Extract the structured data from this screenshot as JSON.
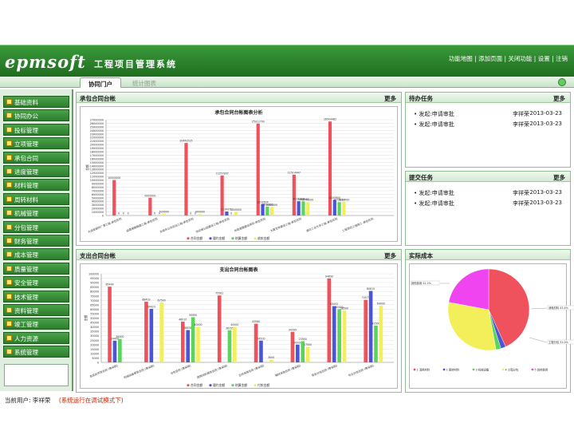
{
  "app": {
    "logo": "epmsoft",
    "title": "工程项目管理系统"
  },
  "top_links": [
    "功能地图",
    "添加页面",
    "关闭功能",
    "设置",
    "注销"
  ],
  "tabs": [
    "协同门户",
    "统计图表"
  ],
  "menu": [
    "基础资料",
    "协同办公",
    "投标管理",
    "立项管理",
    "承包合同",
    "进度管理",
    "材料管理",
    "周转材料",
    "机械管理",
    "分包管理",
    "财务管理",
    "成本管理",
    "质量管理",
    "安全管理",
    "技术管理",
    "资料管理",
    "竣工管理",
    "人力资源",
    "系统管理"
  ],
  "panels": {
    "contract": {
      "title": "承包合同台帐",
      "more": "更多",
      "chart_title": "承包合同台帐图表分析"
    },
    "outsource": {
      "title": "支出合同台帐",
      "more": "更多",
      "chart_title": "支出合同台帐图表"
    },
    "todo": {
      "title": "待办任务",
      "more": "更多",
      "items": [
        {
          "name": "发起:申请审批",
          "user": "李祥荣",
          "date": "2013-03-23"
        },
        {
          "name": "发起:申请审批",
          "user": "李祥荣",
          "date": "2013-03-23"
        }
      ]
    },
    "submit": {
      "title": "提交任务",
      "more": "更多",
      "items": [
        {
          "name": "发起:申请审批",
          "user": "李祥荣",
          "date": "2013-03-23"
        },
        {
          "name": "发起:申请审批",
          "user": "李祥荣",
          "date": "2013-03-23"
        }
      ]
    },
    "cost": {
      "title": "实际成本"
    }
  },
  "status": {
    "user_label": "当前用户: 李祥荣",
    "mode": "(系统运行在调试模式下)"
  },
  "colors": {
    "red": "#f0525d",
    "blue": "#4a55d8",
    "green": "#59d45c",
    "yellow": "#f3ef5a",
    "magenta": "#ef44ef",
    "header_green": "#2d7d2d"
  },
  "chart_data": [
    {
      "type": "bar",
      "title": "承包合同台帐图表分析",
      "ylabel": "金额",
      "ylim": [
        0,
        27000000
      ],
      "yticks": [
        0,
        1000000,
        2000000,
        3000000,
        4000000,
        5000000,
        6000000,
        7000000,
        8000000,
        9000000,
        10000000,
        11000000,
        12000000,
        13000000,
        14000000,
        15000000,
        16000000,
        17000000,
        18000000,
        19000000,
        20000000,
        21000000,
        22000000,
        23000000,
        24000000,
        25000000,
        26000000,
        27000000
      ],
      "categories": [
        "大润发超市广源工程-承包合同",
        "成高速路路面工程-承包合同",
        "东莞市公交总站工程-承包合同",
        "世纪城公园建设工程-承包合同",
        "市政道路建设项目-承包合同",
        "大厦主体建设工程-承包合同",
        "湖北工业大学工程-承包合同",
        "工程项目工程施工-承包合同"
      ],
      "series": [
        {
          "name": "合同金额",
          "values": [
            10000000,
            5000000,
            20442515,
            11257907,
            25912700,
            11514447,
            26504482,
            0
          ]
        },
        {
          "name": "履约金额",
          "values": [
            0,
            0,
            0,
            1134370,
            3201604,
            4021204,
            4403900,
            0
          ]
        },
        {
          "name": "结算金额",
          "values": [
            0,
            0,
            0,
            0,
            2500000,
            3964567,
            3773117,
            0
          ]
        },
        {
          "name": "收款金额",
          "values": [
            0,
            500000,
            400000,
            1000000,
            2400000,
            3770000,
            3860000,
            0
          ]
        }
      ],
      "data_labels": [
        [
          "10000000",
          "0",
          "0",
          "0"
        ],
        [
          "5000000",
          "0",
          "0",
          "500000"
        ],
        [
          "20442515",
          "0",
          "0",
          "400000"
        ],
        [
          "11257907",
          "1134370",
          "0",
          "1000000"
        ],
        [
          "25912700",
          "3201604",
          "2500000",
          "2400000"
        ],
        [
          "11514447",
          "4021204",
          "3964567",
          "3770000"
        ],
        [
          "26504482",
          "4403900",
          "3773117",
          "3860000"
        ],
        [
          "",
          "",
          "",
          ""
        ]
      ],
      "legend_position": "bottom"
    },
    {
      "type": "bar",
      "title": "支出合同台帐图表",
      "ylabel": "金额",
      "ylim": [
        0,
        100000
      ],
      "yticks": [
        0,
        5000,
        10000,
        15000,
        20000,
        25000,
        30000,
        35000,
        40000,
        45000,
        50000,
        55000,
        60000,
        65000,
        70000,
        75000,
        80000,
        85000,
        90000,
        95000,
        100000
      ],
      "categories": [
        "商品砼供货合同 (零采购)",
        "机械设备租赁合同 (零采购)",
        "分包合同 (零采购)",
        "周转材料租赁合同 (零采购)",
        "主材采购合同 (零采购)",
        "辅材采购合同 (零采购)",
        "劳务分包合同 (零采购)",
        "专业分包合同 (零采购)"
      ],
      "series": [
        {
          "name": "合同金额",
          "values": [
            85444,
            68403,
            46010,
            75561,
            43560,
            34395,
            94690,
            70573
          ]
        },
        {
          "name": "履约金额",
          "values": [
            24400,
            60423,
            36450,
            0,
            24500,
            20000,
            63452,
            80615
          ]
        },
        {
          "name": "结算金额",
          "values": [
            26400,
            0,
            50950,
            36155,
            0,
            23900,
            60000,
            41500
          ]
        },
        {
          "name": "付款金额",
          "values": [
            0,
            67500,
            40000,
            40000,
            3000,
            17500,
            58500,
            64000
          ]
        }
      ],
      "data_labels": [
        [
          "85444",
          "24400",
          "26400",
          ""
        ],
        [
          "68403",
          "60423",
          "",
          "67500"
        ],
        [
          "46010",
          "36450",
          "50950",
          "40000"
        ],
        [
          "75561",
          "",
          "36155",
          "40000"
        ],
        [
          "43560",
          "24500",
          "",
          "3000"
        ],
        [
          "34395",
          "20000",
          "23900",
          "17500"
        ],
        [
          "94690",
          "63452",
          "60000",
          "58500"
        ],
        [
          "70573",
          "80615",
          "41500",
          "64000"
        ]
      ],
      "legend_position": "bottom"
    },
    {
      "type": "pie",
      "title": "",
      "slices": [
        {
          "name": "消耗材料",
          "value": 43.4
        },
        {
          "name": "周转材料",
          "value": 2.0
        },
        {
          "name": "机械设备",
          "value": 2.0
        },
        {
          "name": "工程分包",
          "value": 31.0
        },
        {
          "name": "其他费用",
          "value": 22.2
        }
      ],
      "labels": [
        "消耗材料 43.4%",
        "工程分包 31.0%",
        "其他费用 22.2%"
      ],
      "legend": [
        "1 消耗材料",
        "2 周转材料",
        "3 机械设备",
        "4 工程分包",
        "5 其他费用"
      ],
      "legend_position": "bottom"
    }
  ]
}
